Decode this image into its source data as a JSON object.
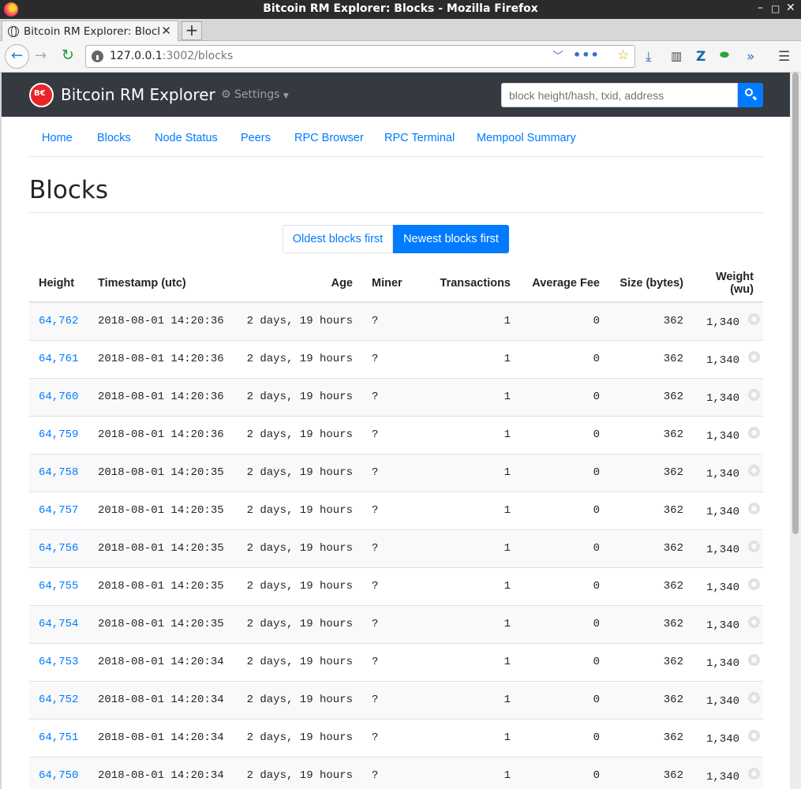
{
  "window": {
    "title": "Bitcoin RM Explorer: Blocks - Mozilla Firefox",
    "minimize": "–",
    "maximize": "□",
    "close": "✕"
  },
  "browser": {
    "tab_title": "Bitcoin RM Explorer: Blocks",
    "tab_close": "✕",
    "new_tab": "+",
    "url_host": "127.0.0.1",
    "url_path": ":3002/blocks"
  },
  "site": {
    "brand": "Bitcoin RM Explorer",
    "settings_label": "Settings",
    "search_placeholder": "block height/hash, txid, address"
  },
  "nav": {
    "home": "Home",
    "blocks": "Blocks",
    "node_status": "Node Status",
    "peers": "Peers",
    "rpc_browser": "RPC Browser",
    "rpc_terminal": "RPC Terminal",
    "mempool_summary": "Mempool Summary"
  },
  "page": {
    "title": "Blocks",
    "sort_oldest": "Oldest blocks first",
    "sort_newest": "Newest blocks first",
    "active_sort": "newest"
  },
  "table": {
    "headers": {
      "height": "Height",
      "timestamp": "Timestamp (utc)",
      "age": "Age",
      "miner": "Miner",
      "transactions": "Transactions",
      "average_fee": "Average Fee",
      "size": "Size (bytes)",
      "weight": "Weight (wu)"
    },
    "rows": [
      {
        "height": "64,762",
        "timestamp": "2018-08-01 14:20:36",
        "age": "2 days, 19 hours",
        "miner": "?",
        "transactions": "1",
        "average_fee": "0",
        "size": "362",
        "weight": "1,340"
      },
      {
        "height": "64,761",
        "timestamp": "2018-08-01 14:20:36",
        "age": "2 days, 19 hours",
        "miner": "?",
        "transactions": "1",
        "average_fee": "0",
        "size": "362",
        "weight": "1,340"
      },
      {
        "height": "64,760",
        "timestamp": "2018-08-01 14:20:36",
        "age": "2 days, 19 hours",
        "miner": "?",
        "transactions": "1",
        "average_fee": "0",
        "size": "362",
        "weight": "1,340"
      },
      {
        "height": "64,759",
        "timestamp": "2018-08-01 14:20:36",
        "age": "2 days, 19 hours",
        "miner": "?",
        "transactions": "1",
        "average_fee": "0",
        "size": "362",
        "weight": "1,340"
      },
      {
        "height": "64,758",
        "timestamp": "2018-08-01 14:20:35",
        "age": "2 days, 19 hours",
        "miner": "?",
        "transactions": "1",
        "average_fee": "0",
        "size": "362",
        "weight": "1,340"
      },
      {
        "height": "64,757",
        "timestamp": "2018-08-01 14:20:35",
        "age": "2 days, 19 hours",
        "miner": "?",
        "transactions": "1",
        "average_fee": "0",
        "size": "362",
        "weight": "1,340"
      },
      {
        "height": "64,756",
        "timestamp": "2018-08-01 14:20:35",
        "age": "2 days, 19 hours",
        "miner": "?",
        "transactions": "1",
        "average_fee": "0",
        "size": "362",
        "weight": "1,340"
      },
      {
        "height": "64,755",
        "timestamp": "2018-08-01 14:20:35",
        "age": "2 days, 19 hours",
        "miner": "?",
        "transactions": "1",
        "average_fee": "0",
        "size": "362",
        "weight": "1,340"
      },
      {
        "height": "64,754",
        "timestamp": "2018-08-01 14:20:35",
        "age": "2 days, 19 hours",
        "miner": "?",
        "transactions": "1",
        "average_fee": "0",
        "size": "362",
        "weight": "1,340"
      },
      {
        "height": "64,753",
        "timestamp": "2018-08-01 14:20:34",
        "age": "2 days, 19 hours",
        "miner": "?",
        "transactions": "1",
        "average_fee": "0",
        "size": "362",
        "weight": "1,340"
      },
      {
        "height": "64,752",
        "timestamp": "2018-08-01 14:20:34",
        "age": "2 days, 19 hours",
        "miner": "?",
        "transactions": "1",
        "average_fee": "0",
        "size": "362",
        "weight": "1,340"
      },
      {
        "height": "64,751",
        "timestamp": "2018-08-01 14:20:34",
        "age": "2 days, 19 hours",
        "miner": "?",
        "transactions": "1",
        "average_fee": "0",
        "size": "362",
        "weight": "1,340"
      },
      {
        "height": "64,750",
        "timestamp": "2018-08-01 14:20:34",
        "age": "2 days, 19 hours",
        "miner": "?",
        "transactions": "1",
        "average_fee": "0",
        "size": "362",
        "weight": "1,340"
      }
    ]
  },
  "colors": {
    "accent": "#007bff",
    "header_bg": "#343a40",
    "logo_red": "#e8262a"
  }
}
